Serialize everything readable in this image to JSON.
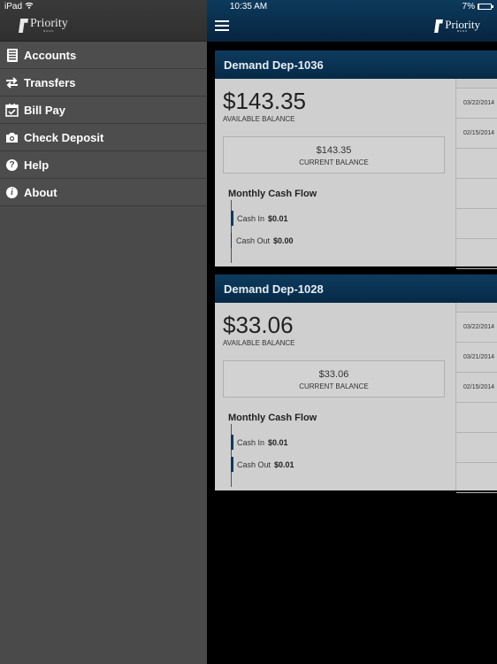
{
  "status_bar": {
    "device": "iPad",
    "time": "10:35 AM",
    "battery_text": "7%",
    "battery_level": 0.07
  },
  "sidebar": {
    "logo": {
      "brand": "Priority",
      "sub": "BANK"
    },
    "items": [
      {
        "label": "Accounts",
        "icon": "accounts-icon"
      },
      {
        "label": "Transfers",
        "icon": "transfers-icon"
      },
      {
        "label": "Bill Pay",
        "icon": "bill-pay-icon"
      },
      {
        "label": "Check Deposit",
        "icon": "camera-icon"
      },
      {
        "label": "Help",
        "icon": "help-icon"
      },
      {
        "label": "About",
        "icon": "info-icon"
      }
    ]
  },
  "topbar": {
    "logo": {
      "brand": "Priority",
      "sub": "BANK"
    },
    "menu_icon": "hamburger-icon"
  },
  "accounts": [
    {
      "name": "Demand Dep-1036",
      "available_balance": "$143.35",
      "available_label": "AVAILABLE BALANCE",
      "current_balance": "$143.35",
      "current_label": "CURRENT BALANCE",
      "flow_title": "Monthly Cash Flow",
      "cash_in_label": "Cash In",
      "cash_in_value": "$0.01",
      "cash_out_label": "Cash Out",
      "cash_out_value": "$0.00",
      "transactions": [
        "03/22/2014",
        "02/15/2014",
        "",
        "",
        "",
        ""
      ]
    },
    {
      "name": "Demand Dep-1028",
      "available_balance": "$33.06",
      "available_label": "AVAILABLE BALANCE",
      "current_balance": "$33.06",
      "current_label": "CURRENT BALANCE",
      "flow_title": "Monthly Cash Flow",
      "cash_in_label": "Cash In",
      "cash_in_value": "$0.01",
      "cash_out_label": "Cash Out",
      "cash_out_value": "$0.01",
      "transactions": [
        "03/22/2014",
        "03/21/2014",
        "02/15/2014",
        "",
        "",
        ""
      ]
    }
  ],
  "colors": {
    "header_blue": "#0d3a5c",
    "sidebar_gray": "#4a4a4a",
    "card_gray": "#cfcfcf"
  }
}
